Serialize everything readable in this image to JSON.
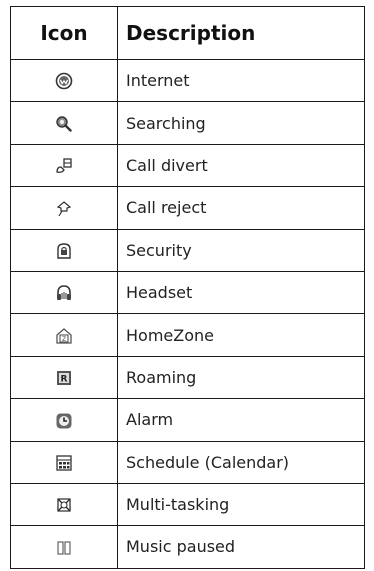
{
  "header": {
    "icon_label": "Icon",
    "description_label": "Description"
  },
  "rows": [
    {
      "icon": "internet-icon",
      "description": "Internet"
    },
    {
      "icon": "searching-icon",
      "description": "Searching"
    },
    {
      "icon": "call-divert-icon",
      "description": "Call divert"
    },
    {
      "icon": "call-reject-icon",
      "description": "Call reject"
    },
    {
      "icon": "security-icon",
      "description": "Security"
    },
    {
      "icon": "headset-icon",
      "description": "Headset"
    },
    {
      "icon": "homezone-icon",
      "description": "HomeZone"
    },
    {
      "icon": "roaming-icon",
      "description": "Roaming"
    },
    {
      "icon": "alarm-icon",
      "description": "Alarm"
    },
    {
      "icon": "schedule-icon",
      "description": "Schedule (Calendar)"
    },
    {
      "icon": "multi-tasking-icon",
      "description": "Multi-tasking"
    },
    {
      "icon": "music-paused-icon",
      "description": "Music paused"
    }
  ]
}
